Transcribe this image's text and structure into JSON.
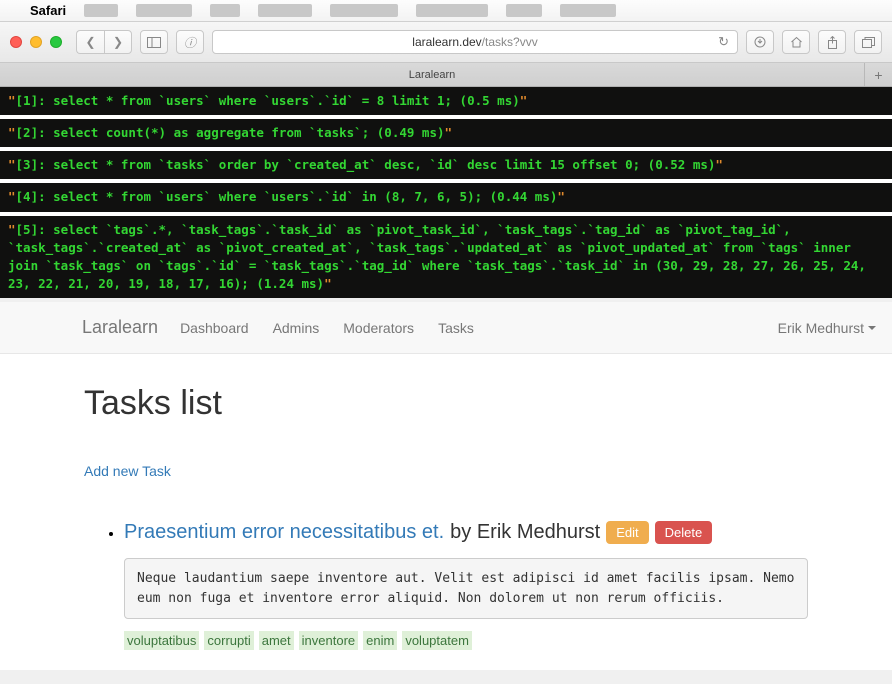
{
  "menubar": {
    "app_name": "Safari",
    "blurred_items": [
      "████",
      "███████",
      "████",
      "███████",
      "████████",
      "█████████",
      "████",
      "███████"
    ]
  },
  "browser": {
    "url_prefix": "laralearn.dev",
    "url_suffix": "/tasks?vvv",
    "tab_title": "Laralearn"
  },
  "sql_queries": [
    "[1]: select * from `users` where `users`.`id` = 8 limit 1; (0.5 ms)",
    "[2]: select count(*) as aggregate from `tasks`; (0.49 ms)",
    "[3]: select * from `tasks` order by `created_at` desc, `id` desc limit 15 offset 0; (0.52 ms)",
    "[4]: select * from `users` where `users`.`id` in (8, 7, 6, 5); (0.44 ms)",
    "[5]: select `tags`.*, `task_tags`.`task_id` as `pivot_task_id`, `task_tags`.`tag_id` as `pivot_tag_id`, `task_tags`.`created_at` as `pivot_created_at`, `task_tags`.`updated_at` as `pivot_updated_at` from `tags` inner join `task_tags` on `tags`.`id` = `task_tags`.`tag_id` where `task_tags`.`task_id` in (30, 29, 28, 27, 26, 25, 24, 23, 22, 21, 20, 19, 18, 17, 16); (1.24 ms)"
  ],
  "navbar": {
    "brand": "Laralearn",
    "links": [
      "Dashboard",
      "Admins",
      "Moderators",
      "Tasks"
    ],
    "user_name": "Erik Medhurst"
  },
  "page": {
    "title": "Tasks list",
    "add_link": "Add new Task",
    "tasks": [
      {
        "title": "Praesentium error necessitatibus et.",
        "by_prefix": "by",
        "author": "Erik Medhurst",
        "edit_label": "Edit",
        "delete_label": "Delete",
        "description": "Neque laudantium saepe inventore aut. Velit est adipisci id amet facilis ipsam. Nemo eum non fuga et inventore error aliquid. Non dolorem ut non rerum officiis.",
        "tags": [
          "voluptatibus",
          "corrupti",
          "amet",
          "inventore",
          "enim",
          "voluptatem"
        ]
      }
    ]
  }
}
